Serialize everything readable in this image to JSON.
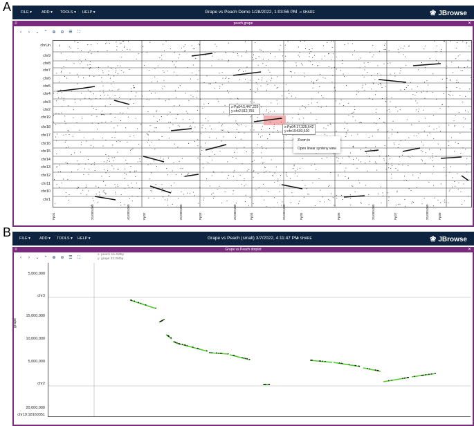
{
  "panel_a": {
    "letter": "A",
    "menus": [
      "FILE ▾",
      "ADD ▾",
      "TOOLS ▾",
      "HELP ▾"
    ],
    "title": "Grape vs Peach Demo 1/28/2022, 1:03:56 PM",
    "share": "SHARE",
    "logo": "JBrowse",
    "view_title": "peach,grape",
    "toolbar": [
      "‹",
      "›",
      "⌄",
      "⌃",
      "⊕",
      "⊖",
      "☰",
      "⛶"
    ],
    "y_labels": [
      "chrUn",
      "chr9",
      "chr8",
      "chr7",
      "chr6",
      "chr5",
      "chr4",
      "chr3",
      "chr2",
      "chr19",
      "chr18",
      "chr17",
      "chr16",
      "chr15",
      "chr14",
      "chr13",
      "chr12",
      "chr11",
      "chr10",
      "chr1"
    ],
    "x_labels": [
      "Pp01",
      "20,000,000",
      "40,000,000",
      "Pp02",
      "20,000,000",
      "Pp03",
      "20,000,000",
      "Pp04",
      "20,000,000",
      "Pp05",
      "Pp06",
      "20,000,000",
      "Pp07",
      "20,000,000",
      "Pp08"
    ],
    "tooltip1": [
      "x-Pp04:5,447,226",
      "y-chr2:312,766"
    ],
    "tooltip2": [
      "x-Pp04:17,325,642",
      "y-chr19:593,620"
    ],
    "context_menu": [
      "Zoom in",
      "Open linear synteny view"
    ],
    "highlight_color": "#f4a6a6"
  },
  "panel_b": {
    "letter": "B",
    "menus": [
      "FILE ▾",
      "ADD ▾",
      "TOOLS ▾",
      "HELP ▾"
    ],
    "title": "Grape vs Peach (small) 3/7/2022, 4:11:47 PM",
    "share": "SHARE",
    "logo": "JBrowse",
    "view_title": "Grape vs Peach dotplot",
    "toolbar": [
      "‹",
      "›",
      "⌄",
      "⌃",
      "⊕",
      "⊖",
      "☰",
      "⛶"
    ],
    "info": [
      "x: peach 16.4Mbp",
      "y: grape 32.2Mbp"
    ],
    "y_axis_title": "grape",
    "y_labels": [
      "5,000,000",
      "chr3",
      "15,000,000",
      "10,000,000",
      "5,000,000",
      "chr2",
      "20,000,000",
      "chr19:18160351"
    ],
    "dot_color": "#4ccc2a"
  },
  "colors": {
    "appbar": "#0d233f",
    "view_header": "#7a2a7c",
    "dots": "#111111"
  }
}
